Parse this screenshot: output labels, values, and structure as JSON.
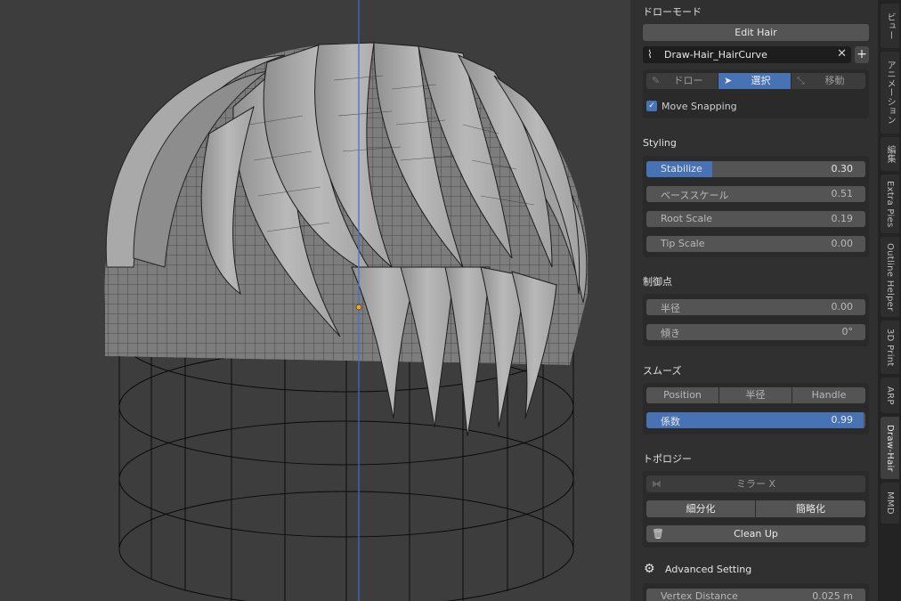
{
  "colors": {
    "accent": "#4772b3",
    "panel_bg": "#303030",
    "viewport_bg": "#3d3d3d",
    "z_axis": "#3d6fd6",
    "origin": "#f5a623"
  },
  "panel": {
    "mode_title": "ドローモード",
    "edit_hair_label": "Edit Hair",
    "curve_name": "Draw-Hair_HairCurve",
    "curve_icon": "hair-curve-icon",
    "tools": [
      {
        "label": "ドロー",
        "icon": "pencil-icon",
        "active": false
      },
      {
        "label": "選択",
        "icon": "cursor-icon",
        "active": true
      },
      {
        "label": "移動",
        "icon": "move-icon",
        "active": false
      }
    ],
    "move_snapping": {
      "label": "Move Snapping",
      "checked": true
    },
    "styling": {
      "title": "Styling",
      "fields": [
        {
          "label": "Stabilize",
          "value": "0.30",
          "fraction": 0.3
        },
        {
          "label": "ベーススケール",
          "value": "0.51"
        },
        {
          "label": "Root Scale",
          "value": "0.19"
        },
        {
          "label": "Tip Scale",
          "value": "0.00"
        }
      ]
    },
    "control_points": {
      "title": "制御点",
      "fields": [
        {
          "label": "半径",
          "value": "0.00"
        },
        {
          "label": "傾き",
          "value": "0°"
        }
      ]
    },
    "smooth": {
      "title": "スムーズ",
      "modes": [
        "Position",
        "半径",
        "Handle"
      ],
      "factor": {
        "label": "係数",
        "value": "0.99",
        "fraction": 0.99
      }
    },
    "topology": {
      "title": "トポロジー",
      "mirror_label": "ミラー X",
      "subdivide_label": "細分化",
      "simplify_label": "簡略化",
      "cleanup_label": "Clean Up"
    },
    "advanced": {
      "title": "Advanced Setting",
      "vertex_distance": {
        "label": "Vertex Distance",
        "value": "0.025 m"
      }
    }
  },
  "tabs": [
    "ビュー",
    "アニメーション",
    "編集",
    "Extra Pies",
    "Outline Helper",
    "3D Print",
    "ARP",
    "Draw-Hair",
    "MMD"
  ],
  "active_tab": "Draw-Hair"
}
